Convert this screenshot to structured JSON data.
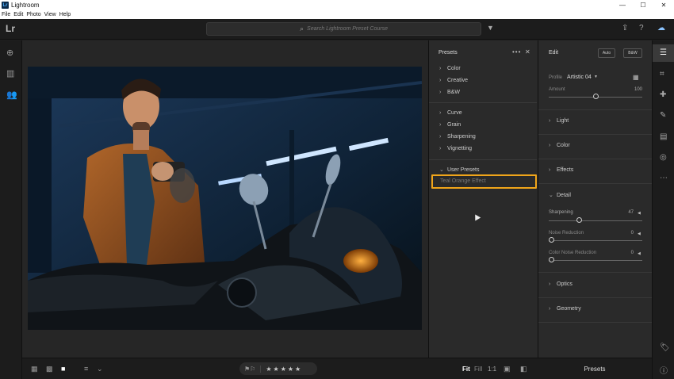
{
  "window": {
    "title": "Lightroom",
    "logo_text": "Lr",
    "minimize": "—",
    "maximize": "☐",
    "close": "✕"
  },
  "menu": [
    "File",
    "Edit",
    "Photo",
    "View",
    "Help"
  ],
  "topbar": {
    "app_mark": "Lr",
    "search_placeholder": "Search Lightroom Preset Course"
  },
  "presets_panel": {
    "title": "Presets",
    "groups_a": [
      "Color",
      "Creative",
      "B&W"
    ],
    "groups_b": [
      "Curve",
      "Grain",
      "Sharpening",
      "Vignetting"
    ],
    "user_group": "User Presets",
    "selected_preset": "Teal Orange Effect"
  },
  "edit_panel": {
    "title": "Edit",
    "auto_label": "Auto",
    "bw_label": "B&W",
    "profile_label": "Profile",
    "profile_value": "Artistic 04",
    "amount_label": "Amount",
    "amount_value": "100",
    "amount_fraction": 0.5,
    "sections": [
      "Light",
      "Color",
      "Effects"
    ],
    "detail_label": "Detail",
    "sharpening_label": "Sharpening",
    "sharpening_value": "47",
    "sharpening_fraction": 0.33,
    "noise_label": "Noise Reduction",
    "noise_value": "0",
    "color_noise_label": "Color Noise Reduction",
    "color_noise_value": "0",
    "sections_after": [
      "Optics",
      "Geometry"
    ],
    "bottom_label": "Presets"
  },
  "bottombar": {
    "stars": "★★★★★",
    "fit": "Fit",
    "fill": "Fill",
    "ratio": "1:1"
  },
  "colors": {
    "accent_highlight": "#f0a51a",
    "panel_bg": "#2a2a2a",
    "chrome_bg": "#1c1c1c"
  }
}
